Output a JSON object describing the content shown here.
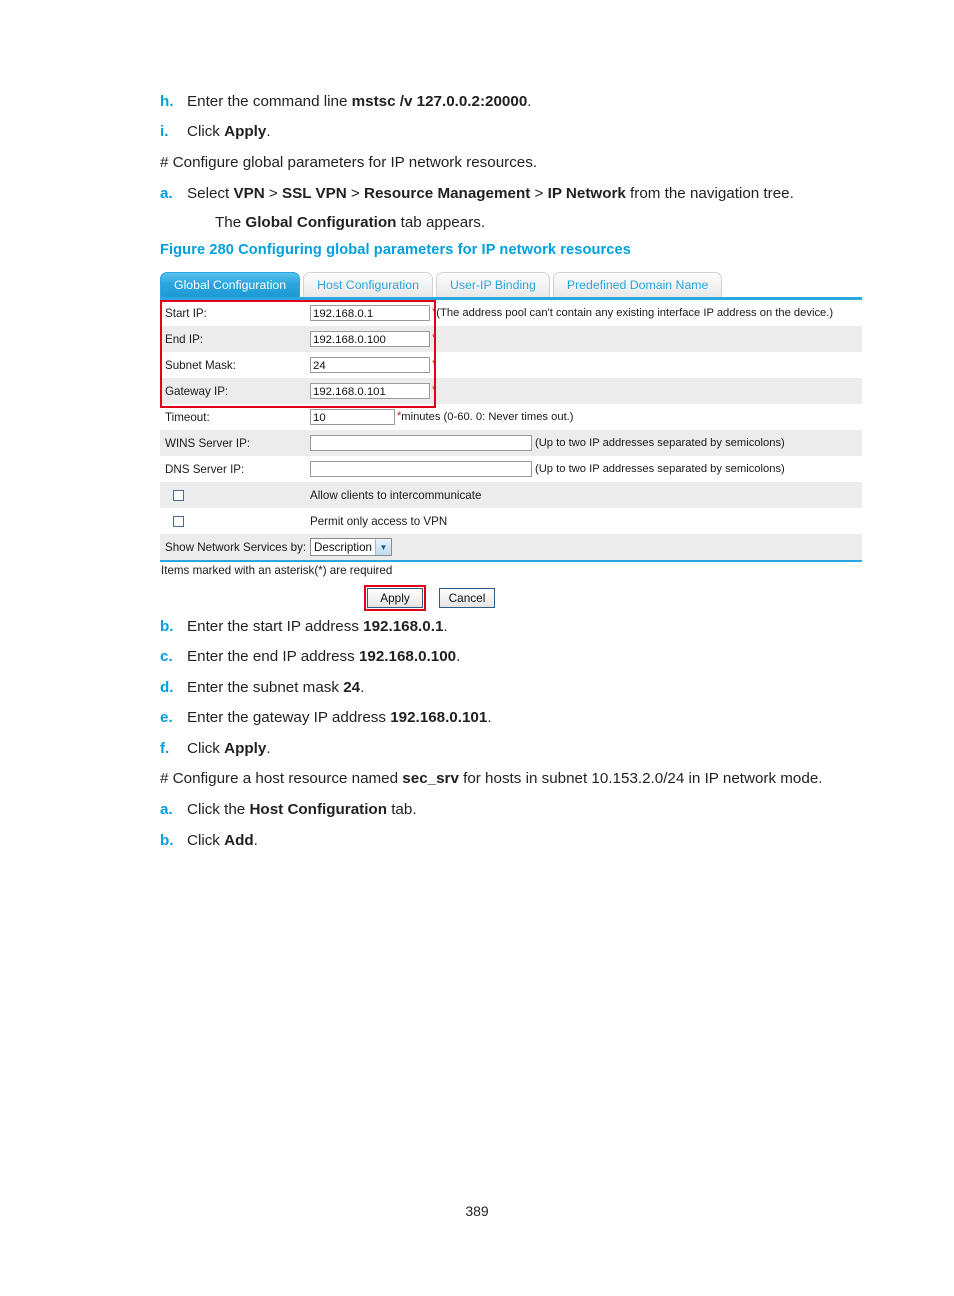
{
  "document": {
    "page_number": "389"
  },
  "steps_top": [
    {
      "marker": "h.",
      "text_parts": [
        {
          "t": "Enter the command line ",
          "b": false
        },
        {
          "t": "mstsc /v 127.0.0.2:20000",
          "b": true
        },
        {
          "t": ".",
          "b": false
        }
      ]
    },
    {
      "marker": "i.",
      "text_parts": [
        {
          "t": "Click ",
          "b": false
        },
        {
          "t": "Apply",
          "b": true
        },
        {
          "t": ".",
          "b": false
        }
      ]
    },
    {
      "marker": "",
      "text_parts": [
        {
          "t": "# Configure global parameters for IP network resources.",
          "b": false
        }
      ]
    },
    {
      "marker": "a.",
      "text_parts": [
        {
          "t": "Select ",
          "b": false
        },
        {
          "t": "VPN",
          "b": true
        },
        {
          "t": " > ",
          "b": false
        },
        {
          "t": "SSL VPN",
          "b": true
        },
        {
          "t": " > ",
          "b": false
        },
        {
          "t": "Resource Management",
          "b": true
        },
        {
          "t": " > ",
          "b": false
        },
        {
          "t": "IP Network",
          "b": true
        },
        {
          "t": " from the navigation tree.",
          "b": false
        }
      ]
    },
    {
      "marker": "",
      "indent": true,
      "text_parts": [
        {
          "t": "The ",
          "b": false
        },
        {
          "t": "Global Configuration",
          "b": true
        },
        {
          "t": " tab appears.",
          "b": false
        }
      ]
    }
  ],
  "figure": {
    "caption": "Figure 280 Configuring global parameters for IP network resources"
  },
  "ui": {
    "tabs": [
      {
        "label": "Global Configuration",
        "active": true
      },
      {
        "label": "Host Configuration",
        "active": false
      },
      {
        "label": "User-IP Binding",
        "active": false
      },
      {
        "label": "Predefined Domain Name",
        "active": false
      }
    ],
    "form_rows": [
      {
        "type": "input",
        "label": "Start IP:",
        "value": "192.168.0.1",
        "required": true,
        "hint": "(The address pool can't contain any existing interface IP address on the device.)",
        "shaded": false,
        "input_size": "wide"
      },
      {
        "type": "input",
        "label": "End IP:",
        "value": "192.168.0.100",
        "required": true,
        "hint": "",
        "shaded": true,
        "input_size": "wide"
      },
      {
        "type": "input",
        "label": "Subnet Mask:",
        "value": "24",
        "required": true,
        "hint": "",
        "shaded": false,
        "input_size": "wide"
      },
      {
        "type": "input",
        "label": "Gateway IP:",
        "value": "192.168.0.101",
        "required": true,
        "hint": "",
        "shaded": true,
        "input_size": "wide"
      },
      {
        "type": "input",
        "label": "Timeout:",
        "value": "10",
        "required": true,
        "hint": "minutes (0-60. 0: Never times out.)",
        "shaded": false,
        "input_size": "small"
      },
      {
        "type": "input",
        "label": "WINS Server IP:",
        "value": "",
        "required": false,
        "hint": "(Up to two IP addresses separated by semicolons)",
        "shaded": true,
        "input_size": "xwide"
      },
      {
        "type": "input",
        "label": "DNS Server IP:",
        "value": "",
        "required": false,
        "hint": "(Up to two IP addresses separated by semicolons)",
        "shaded": false,
        "input_size": "xwide"
      },
      {
        "type": "checkbox",
        "label": "",
        "checked": false,
        "text": "Allow clients to intercommunicate",
        "shaded": true
      },
      {
        "type": "checkbox",
        "label": "",
        "checked": false,
        "text": "Permit only access to VPN",
        "shaded": false
      },
      {
        "type": "select",
        "label": "Show Network Services by:",
        "value": "Description",
        "options": [
          "Description"
        ],
        "shaded": true
      }
    ],
    "required_note": "Items marked with an asterisk(*) are required",
    "buttons": {
      "apply": "Apply",
      "cancel": "Cancel"
    },
    "colors": {
      "accent_blue": "#2ba6de",
      "highlight_red": "#e2001a",
      "caption_blue": "#00a0df",
      "row_shade": "#ececec"
    }
  },
  "steps_bottom": [
    {
      "marker": "b.",
      "text_parts": [
        {
          "t": "Enter the start IP address ",
          "b": false
        },
        {
          "t": "192.168.0.1",
          "b": true
        },
        {
          "t": ".",
          "b": false
        }
      ]
    },
    {
      "marker": "c.",
      "text_parts": [
        {
          "t": "Enter the end IP address ",
          "b": false
        },
        {
          "t": "192.168.0.100",
          "b": true
        },
        {
          "t": ".",
          "b": false
        }
      ]
    },
    {
      "marker": "d.",
      "text_parts": [
        {
          "t": "Enter the subnet mask ",
          "b": false
        },
        {
          "t": "24",
          "b": true
        },
        {
          "t": ".",
          "b": false
        }
      ]
    },
    {
      "marker": "e.",
      "text_parts": [
        {
          "t": "Enter the gateway IP address ",
          "b": false
        },
        {
          "t": "192.168.0.101",
          "b": true
        },
        {
          "t": ".",
          "b": false
        }
      ]
    },
    {
      "marker": "f.",
      "text_parts": [
        {
          "t": "Click ",
          "b": false
        },
        {
          "t": "Apply",
          "b": true
        },
        {
          "t": ".",
          "b": false
        }
      ]
    },
    {
      "marker": "",
      "text_parts": [
        {
          "t": "# Configure a host resource named ",
          "b": false
        },
        {
          "t": "sec_srv",
          "b": true
        },
        {
          "t": " for hosts in subnet 10.153.2.0/24 in IP network mode.",
          "b": false
        }
      ]
    },
    {
      "marker": "a.",
      "text_parts": [
        {
          "t": "Click the ",
          "b": false
        },
        {
          "t": "Host Configuration",
          "b": true
        },
        {
          "t": " tab.",
          "b": false
        }
      ]
    },
    {
      "marker": "b.",
      "text_parts": [
        {
          "t": "Click ",
          "b": false
        },
        {
          "t": "Add",
          "b": true
        },
        {
          "t": ".",
          "b": false
        }
      ]
    }
  ]
}
